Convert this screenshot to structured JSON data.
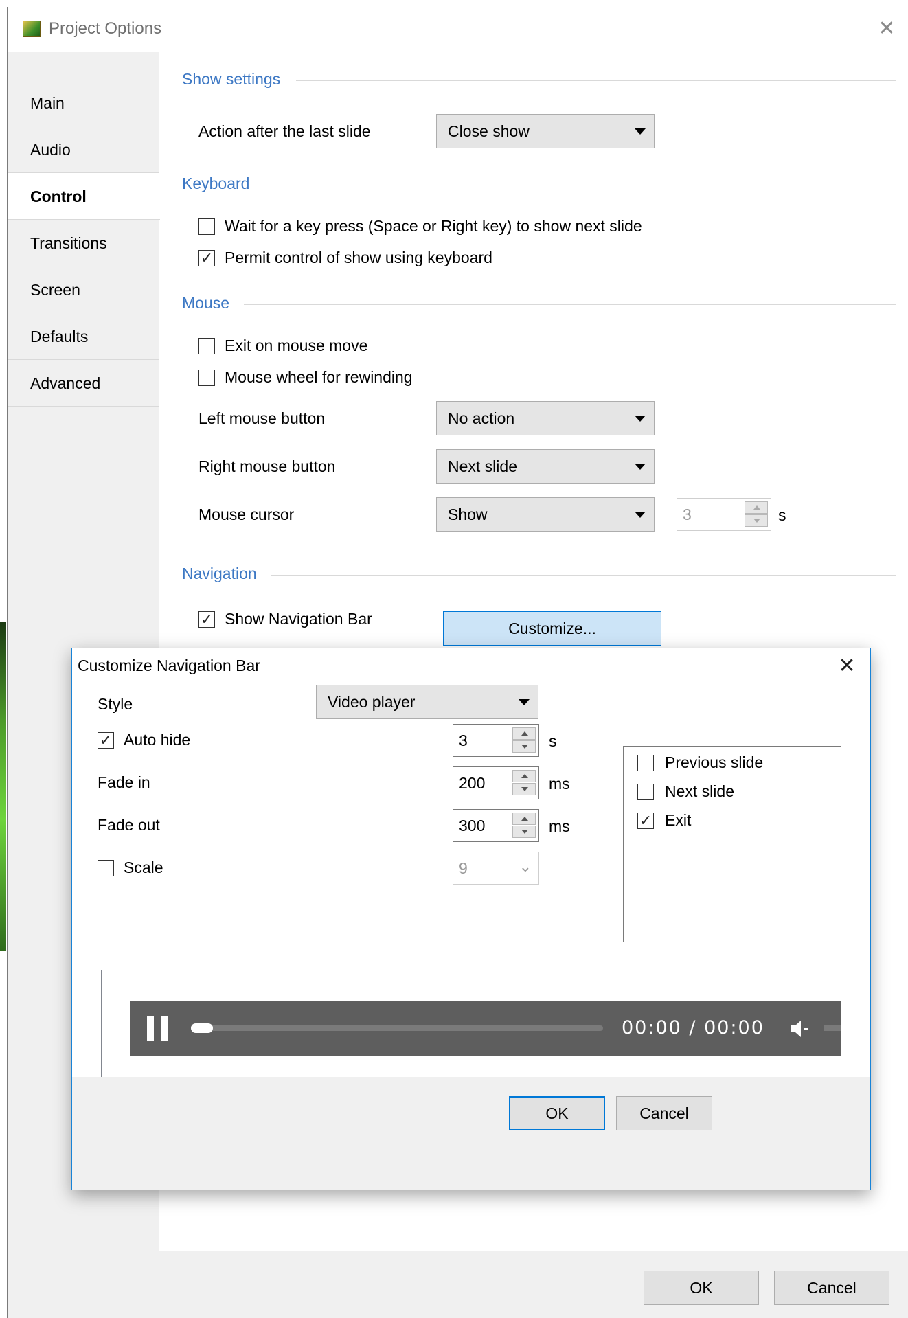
{
  "window": {
    "title": "Project Options"
  },
  "sidebar": {
    "items": [
      {
        "label": "Main"
      },
      {
        "label": "Audio"
      },
      {
        "label": "Control"
      },
      {
        "label": "Transitions"
      },
      {
        "label": "Screen"
      },
      {
        "label": "Defaults"
      },
      {
        "label": "Advanced"
      }
    ],
    "active": "Control"
  },
  "show_settings": {
    "heading": "Show settings",
    "action_label": "Action after the last slide",
    "action_value": "Close show"
  },
  "keyboard": {
    "heading": "Keyboard",
    "wait_key_label": "Wait for a key press (Space or Right key) to show next slide",
    "wait_key_checked": false,
    "permit_label": "Permit control of show using keyboard",
    "permit_checked": true
  },
  "mouse": {
    "heading": "Mouse",
    "exit_label": "Exit on mouse move",
    "exit_checked": false,
    "wheel_label": "Mouse wheel for rewinding",
    "wheel_checked": false,
    "left_label": "Left mouse button",
    "left_value": "No action",
    "right_label": "Right mouse button",
    "right_value": "Next slide",
    "cursor_label": "Mouse cursor",
    "cursor_value": "Show",
    "cursor_seconds": "3",
    "cursor_unit": "s"
  },
  "navigation": {
    "heading": "Navigation",
    "show_bar_label": "Show Navigation Bar",
    "show_bar_checked": true,
    "customize_label": "Customize..."
  },
  "footer": {
    "ok": "OK",
    "cancel": "Cancel"
  },
  "dialog": {
    "title": "Customize Navigation Bar",
    "style_label": "Style",
    "style_value": "Video player",
    "auto_hide_label": "Auto hide",
    "auto_hide_checked": true,
    "auto_hide_value": "3",
    "auto_hide_unit": "s",
    "fade_in_label": "Fade in",
    "fade_in_value": "200",
    "fade_in_unit": "ms",
    "fade_out_label": "Fade out",
    "fade_out_value": "300",
    "fade_out_unit": "ms",
    "scale_label": "Scale",
    "scale_checked": false,
    "scale_value": "9",
    "buttons_list": [
      {
        "label": "Previous slide",
        "checked": false
      },
      {
        "label": "Next slide",
        "checked": false
      },
      {
        "label": "Exit",
        "checked": true
      }
    ],
    "preview": {
      "time": "00:00 / 00:00",
      "progress": 0.0
    },
    "ok": "OK",
    "cancel": "Cancel"
  }
}
